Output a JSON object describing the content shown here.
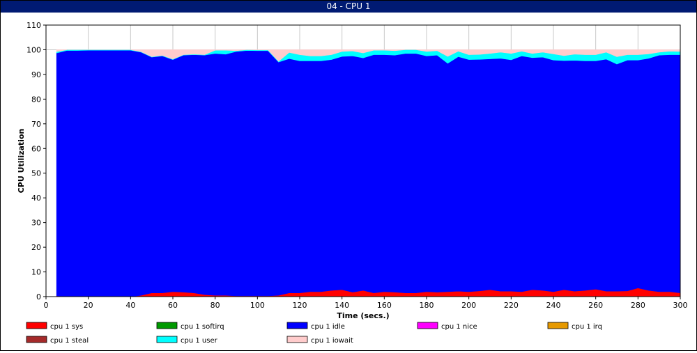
{
  "window": {
    "title": "04 - CPU 1"
  },
  "chart_data": {
    "type": "area",
    "stacked": true,
    "title": "",
    "xlabel": "Time (secs.)",
    "ylabel": "CPU Utilization",
    "xlim": [
      0,
      300
    ],
    "ylim": [
      0,
      110
    ],
    "xticks": [
      0,
      20,
      40,
      60,
      80,
      100,
      120,
      140,
      160,
      180,
      200,
      220,
      240,
      260,
      280,
      300
    ],
    "yticks": [
      0,
      10,
      20,
      30,
      40,
      50,
      60,
      70,
      80,
      90,
      100,
      110
    ],
    "grid": true,
    "legend_position": "bottom",
    "x": [
      5,
      10,
      15,
      20,
      25,
      30,
      35,
      40,
      45,
      50,
      55,
      60,
      65,
      70,
      75,
      80,
      85,
      90,
      95,
      100,
      105,
      110,
      115,
      120,
      125,
      130,
      135,
      140,
      145,
      150,
      155,
      160,
      165,
      170,
      175,
      180,
      185,
      190,
      195,
      200,
      205,
      210,
      215,
      220,
      225,
      230,
      235,
      240,
      245,
      250,
      255,
      260,
      265,
      270,
      275,
      280,
      285,
      290,
      295,
      300
    ],
    "series": [
      {
        "name": "cpu 1 sys",
        "color": "#ff0000",
        "values": [
          0.3,
          0,
          0,
          0,
          0,
          0,
          0,
          0,
          0.5,
          1.5,
          1.5,
          2,
          1.8,
          1.5,
          0.8,
          0.5,
          0.5,
          0.3,
          0.3,
          0.3,
          0.3,
          0.5,
          1.5,
          1.5,
          2,
          2,
          2.5,
          2.8,
          1.8,
          2.5,
          1.5,
          2,
          1.8,
          1.5,
          1.5,
          2,
          1.8,
          2,
          2.2,
          2,
          2.3,
          2.8,
          2.2,
          2.2,
          2,
          2.8,
          2.5,
          2,
          2.8,
          2.2,
          2.5,
          3,
          2.2,
          2.2,
          2.3,
          3.5,
          2.5,
          2,
          2,
          1.5
        ]
      },
      {
        "name": "cpu 1 softirq",
        "color": "#009900",
        "values": []
      },
      {
        "name": "cpu 1 idle",
        "color": "#0000ff",
        "values": [
          98.4,
          99.7,
          99.7,
          99.8,
          99.8,
          99.8,
          99.8,
          99.8,
          98.5,
          95.5,
          96,
          94,
          96,
          96.5,
          97,
          98,
          97.7,
          99,
          99.4,
          99.3,
          99.3,
          94.5,
          94.9,
          94,
          93.5,
          93.5,
          93.5,
          94.5,
          95.7,
          94.2,
          96.5,
          96,
          96,
          97,
          97,
          95.5,
          96,
          92.5,
          95,
          94,
          93.8,
          93.5,
          94.3,
          93.7,
          95.5,
          94,
          94.5,
          93.8,
          92.8,
          93.5,
          93,
          92.5,
          94,
          92,
          93.5,
          92.3,
          94,
          95.8,
          96,
          96.5
        ]
      },
      {
        "name": "cpu 1 nice",
        "color": "#ff00ff",
        "values": []
      },
      {
        "name": "cpu 1 irq",
        "color": "#e69900",
        "values": []
      },
      {
        "name": "cpu 1 steal",
        "color": "#a52a2a",
        "values": []
      },
      {
        "name": "cpu 1 user",
        "color": "#00ffff",
        "values": [
          0.5,
          0.3,
          0.3,
          0.2,
          0.2,
          0.2,
          0.2,
          0.2,
          0.2,
          0.2,
          0.2,
          0.2,
          0.2,
          0.2,
          0.2,
          1.3,
          1.6,
          0.3,
          0.3,
          0.3,
          0.3,
          0.3,
          2.5,
          2.5,
          2,
          2,
          2,
          2,
          2,
          2,
          1.8,
          1.8,
          1.8,
          1.5,
          1.5,
          1.8,
          1.8,
          2.8,
          2.2,
          2,
          2,
          2.2,
          2.5,
          2.6,
          1.9,
          1.7,
          2,
          2.5,
          2,
          2.5,
          2.5,
          2.5,
          2.8,
          3,
          2.2,
          2.2,
          1.8,
          1.2,
          1.4,
          1.3
        ]
      },
      {
        "name": "cpu 1 iowait",
        "color": "#ffcccc",
        "values": [
          0.8,
          0,
          0,
          0,
          0,
          0,
          0,
          0,
          0.8,
          2.8,
          2.3,
          3.8,
          2,
          1.8,
          2,
          0.2,
          0.2,
          0.4,
          0,
          0.1,
          0.1,
          4.7,
          1.1,
          2,
          2.5,
          2.5,
          2,
          0.7,
          0.5,
          1.3,
          0.2,
          0.2,
          0.4,
          0,
          0,
          0.7,
          0.4,
          2.7,
          0.6,
          2,
          1.9,
          1.5,
          1,
          1.5,
          0.6,
          1.5,
          1,
          1.7,
          2.4,
          1.8,
          2,
          2,
          1,
          2.8,
          2,
          2,
          1.7,
          1,
          0.6,
          0.7
        ]
      }
    ]
  }
}
